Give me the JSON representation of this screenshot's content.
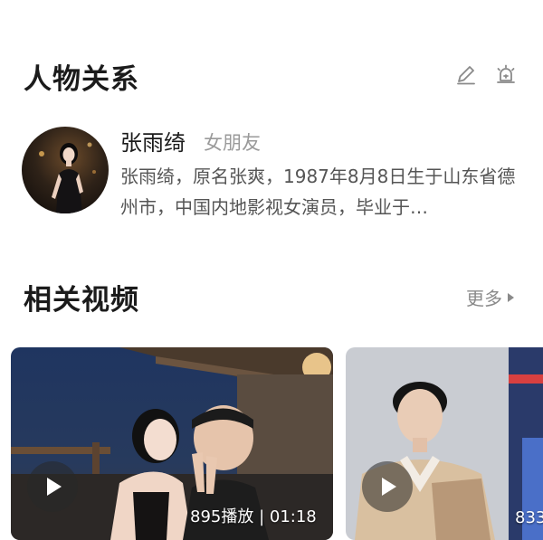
{
  "relationships": {
    "title": "人物关系",
    "person": {
      "name": "张雨绮",
      "relation": "女朋友",
      "description": "张雨绮，原名张爽，1987年8月8日生于山东省德州市，中国内地影视女演员，毕业于…"
    }
  },
  "videos": {
    "title": "相关视频",
    "more_label": "更多",
    "items": [
      {
        "plays": "895播放",
        "duration": "01:18"
      },
      {
        "plays": "833"
      }
    ]
  },
  "colors": {
    "title_text": "#1b1b1b",
    "secondary_text": "#9a9a9a",
    "body_text": "#555555"
  }
}
